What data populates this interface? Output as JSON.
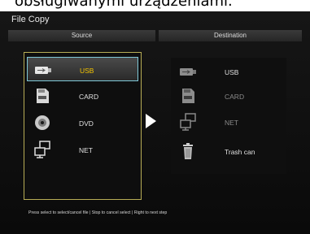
{
  "caption_text": "obsługiwanymi urządzeniami.",
  "window": {
    "title": "File Copy"
  },
  "source": {
    "header": "Source",
    "items": [
      {
        "label": "USB",
        "icon": "usb-icon",
        "selected": true
      },
      {
        "label": "CARD",
        "icon": "card-icon",
        "selected": false
      },
      {
        "label": "DVD",
        "icon": "dvd-icon",
        "selected": false
      },
      {
        "label": "NET",
        "icon": "network-icon",
        "selected": false
      }
    ]
  },
  "destination": {
    "header": "Destination",
    "items": [
      {
        "label": "USB",
        "icon": "usb-icon"
      },
      {
        "label": "CARD",
        "icon": "card-icon"
      },
      {
        "label": "NET",
        "icon": "network-icon"
      },
      {
        "label": "Trash can",
        "icon": "trash-icon"
      }
    ]
  },
  "hint": "Press select to select/cancel file | Stop to cancel select | Right to next step",
  "colors": {
    "accent_selected_text": "#f4c400",
    "panel_border": "#b8ad56",
    "selection_border": "#7fc8d8"
  }
}
